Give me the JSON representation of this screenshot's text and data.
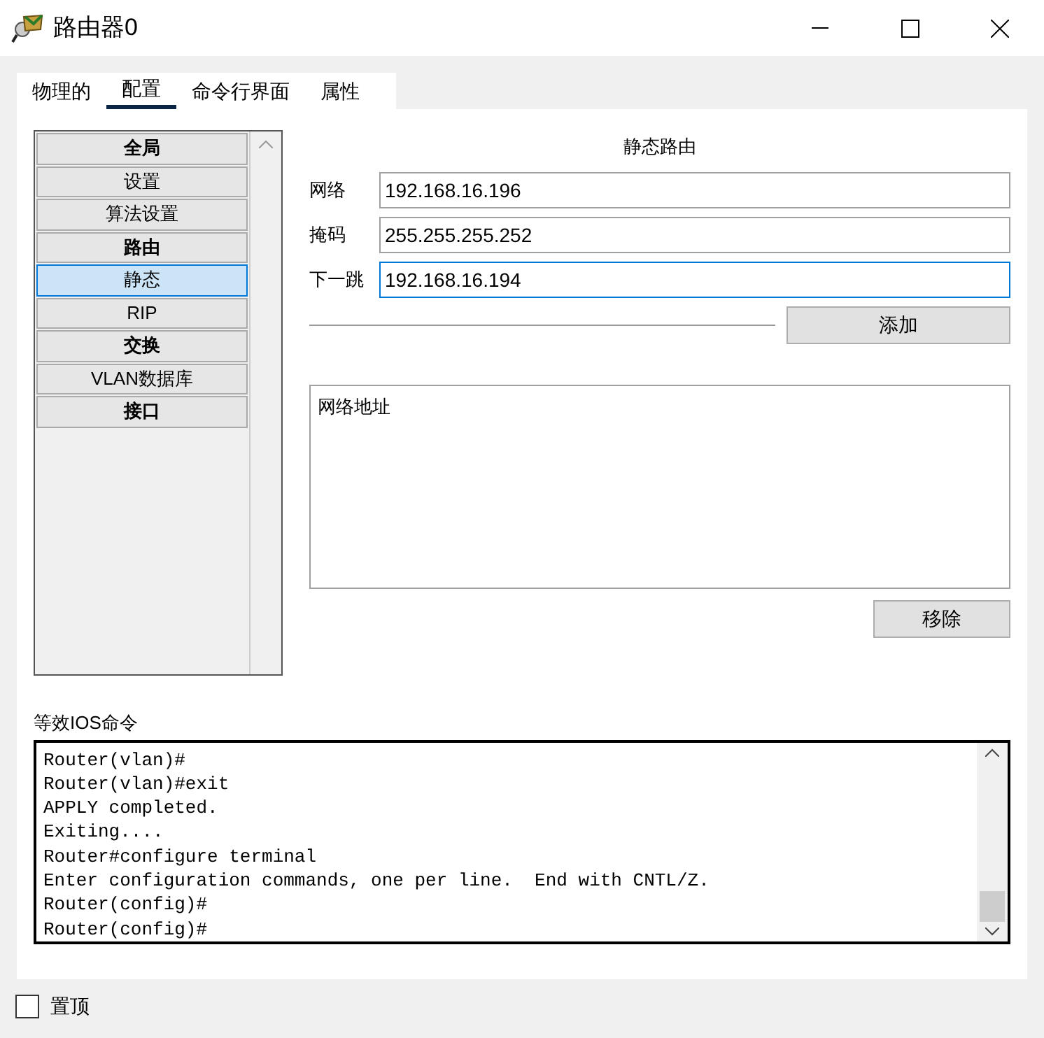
{
  "window": {
    "title": "路由器0"
  },
  "tabs": [
    {
      "label": "物理的",
      "selected": false
    },
    {
      "label": "配置",
      "selected": true
    },
    {
      "label": "命令行界面",
      "selected": false
    },
    {
      "label": "属性",
      "selected": false
    }
  ],
  "sidebar": {
    "items": [
      {
        "label": "全局",
        "kind": "header",
        "selected": false
      },
      {
        "label": "设置",
        "kind": "item",
        "selected": false
      },
      {
        "label": "算法设置",
        "kind": "item",
        "selected": false
      },
      {
        "label": "路由",
        "kind": "header",
        "selected": false
      },
      {
        "label": "静态",
        "kind": "item",
        "selected": true
      },
      {
        "label": "RIP",
        "kind": "item",
        "selected": false
      },
      {
        "label": "交换",
        "kind": "header",
        "selected": false
      },
      {
        "label": "VLAN数据库",
        "kind": "item",
        "selected": false
      },
      {
        "label": "接口",
        "kind": "header",
        "selected": false
      }
    ]
  },
  "static_route": {
    "title": "静态路由",
    "fields": [
      {
        "label": "网络",
        "value": "192.168.16.196",
        "focused": false
      },
      {
        "label": "掩码",
        "value": "255.255.255.252",
        "focused": false
      },
      {
        "label": "下一跳",
        "value": "192.168.16.194",
        "focused": true
      }
    ],
    "add_button": "添加",
    "list_header": "网络地址",
    "remove_button": "移除"
  },
  "ios_commands": {
    "label": "等效IOS命令",
    "lines": [
      {
        "text": "Router(vlan)#"
      },
      {
        "text": "Router(vlan)#exit"
      },
      {
        "text": "APPLY completed."
      },
      {
        "text": "Exiting...."
      },
      {
        "text": "Router#configure terminal"
      },
      {
        "text": "Enter configuration commands, one per line.  End with CNTL/Z."
      },
      {
        "text": "Router(config)#"
      },
      {
        "text": "Router(config)#"
      }
    ]
  },
  "pin_on_top": {
    "label": "置顶",
    "checked": false
  }
}
